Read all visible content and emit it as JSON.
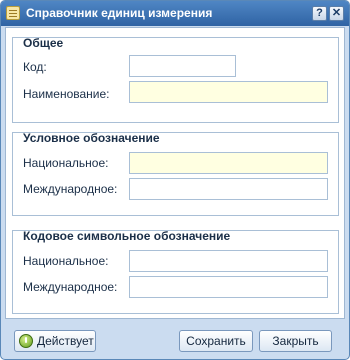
{
  "window": {
    "title": "Справочник единиц измерения",
    "help_glyph": "?",
    "close_glyph": "✕"
  },
  "groups": {
    "general": {
      "legend": "Общее",
      "code_label": "Код:",
      "code_value": "",
      "name_label": "Наименование:",
      "name_value": ""
    },
    "conventional": {
      "legend": "Условное обозначение",
      "national_label": "Национальное:",
      "national_value": "",
      "international_label": "Международное:",
      "international_value": ""
    },
    "code_symbol": {
      "legend": "Кодовое символьное обозначение",
      "national_label": "Национальное:",
      "national_value": "",
      "international_label": "Международное:",
      "international_value": ""
    }
  },
  "footer": {
    "status_label": "Действует",
    "save_label": "Сохранить",
    "close_label": "Закрыть"
  },
  "colors": {
    "required_field": "#ffffe1",
    "titlebar": "#3a6fb0"
  }
}
